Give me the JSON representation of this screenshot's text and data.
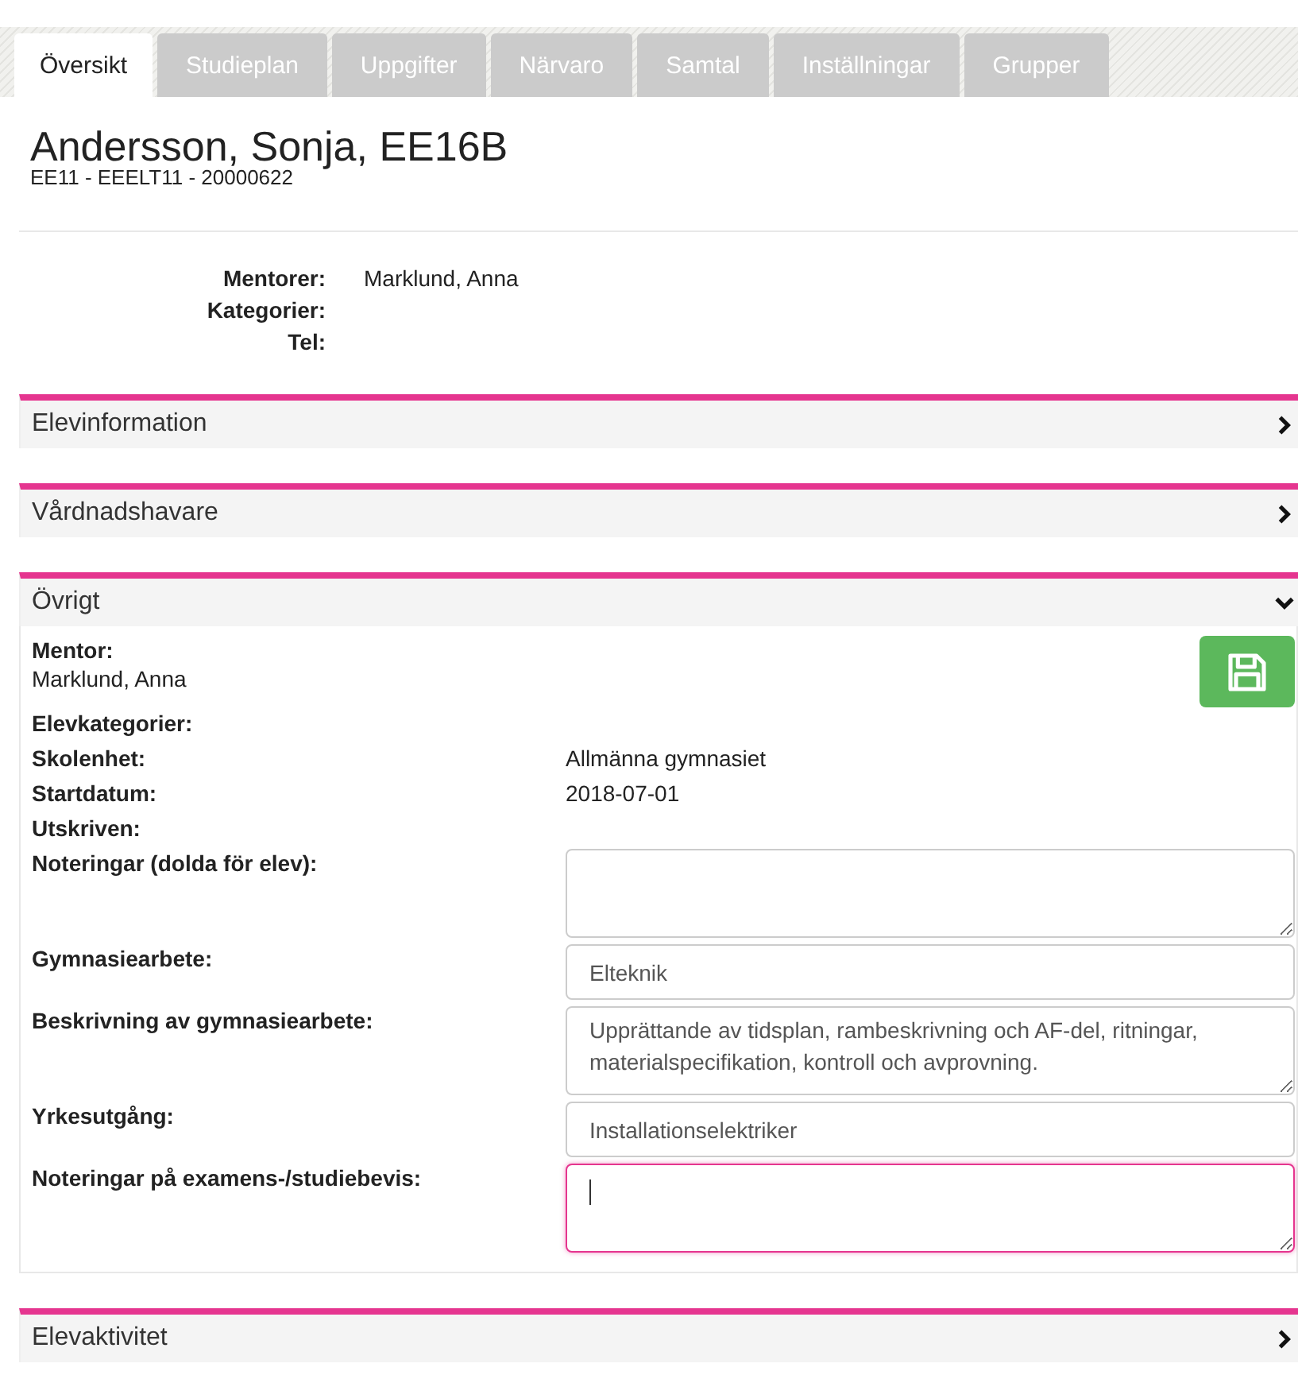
{
  "tabs": [
    {
      "label": "Översikt",
      "selected": true
    },
    {
      "label": "Studieplan",
      "selected": false
    },
    {
      "label": "Uppgifter",
      "selected": false
    },
    {
      "label": "Närvaro",
      "selected": false
    },
    {
      "label": "Samtal",
      "selected": false
    },
    {
      "label": "Inställningar",
      "selected": false
    },
    {
      "label": "Grupper",
      "selected": false
    }
  ],
  "student": {
    "name": "Andersson, Sonja, EE16B",
    "subtitle": "EE11 - EEELT11 - 20000622"
  },
  "info": [
    {
      "label": "Mentorer:",
      "value": "Marklund, Anna"
    },
    {
      "label": "Kategorier:"
    },
    {
      "label": "Tel:"
    }
  ],
  "panels": [
    {
      "title": "Elevinformation",
      "expanded": false
    },
    {
      "title": "Vårdnadshavare",
      "expanded": false
    },
    {
      "title": "Övrigt",
      "expanded": true,
      "rows": [
        {
          "kind": "stacked",
          "label": "Mentor:",
          "value": "Marklund, Anna"
        },
        {
          "kind": "text",
          "label": "Elevkategorier:"
        },
        {
          "kind": "text",
          "label": "Skolenhet:",
          "value": "Allmänna gymnasiet"
        },
        {
          "kind": "text",
          "label": "Startdatum:",
          "value": "2018-07-01"
        },
        {
          "kind": "text",
          "label": "Utskriven:"
        },
        {
          "kind": "textarea",
          "label": "Noteringar (dolda för elev):",
          "focused": false
        },
        {
          "kind": "input",
          "label": "Gymnasiearbete:",
          "value": "Elteknik"
        },
        {
          "kind": "textarea",
          "label": "Beskrivning av gymnasiearbete:",
          "value": "Upprättande av tidsplan, rambeskrivning och AF-del, ritningar, materialspecifikation, kontroll och avprovning.",
          "focused": false
        },
        {
          "kind": "input",
          "label": "Yrkesutgång:",
          "value": "Installationselektriker"
        },
        {
          "kind": "textarea",
          "label": "Noteringar på examens-/studiebevis:",
          "focused": true
        }
      ]
    },
    {
      "title": "Elevaktivitet",
      "expanded": false
    }
  ]
}
